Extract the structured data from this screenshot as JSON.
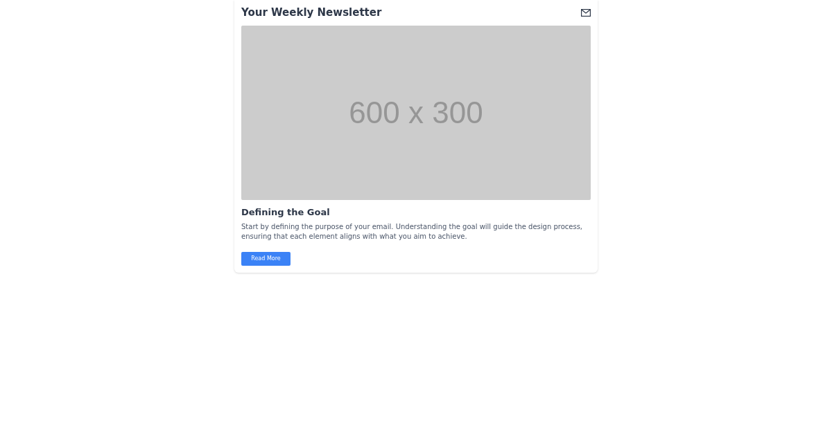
{
  "header": {
    "title": "Your Weekly Newsletter"
  },
  "image": {
    "label": "600 x 300"
  },
  "article": {
    "heading": "Defining the Goal",
    "body": "Start by defining the purpose of your email. Understanding the goal will guide the design process, ensuring that each element aligns with what you aim to achieve.",
    "button": "Read More"
  }
}
